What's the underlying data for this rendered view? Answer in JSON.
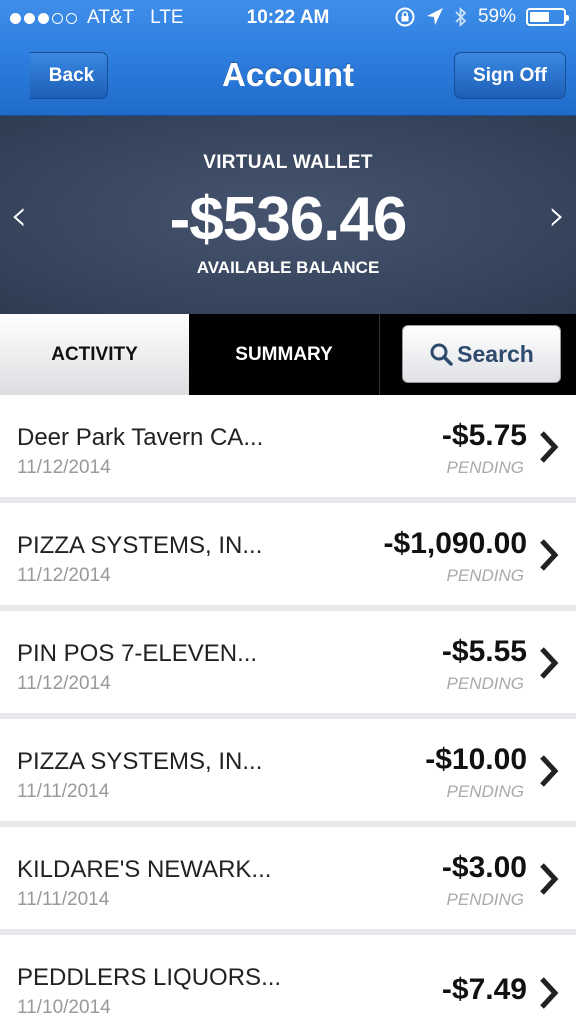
{
  "status_bar": {
    "carrier": "AT&T",
    "network": "LTE",
    "time": "10:22 AM",
    "battery": "59%",
    "battery_level": 0.59,
    "signal_bars_filled": 3,
    "signal_bars_total": 5
  },
  "nav": {
    "back_label": "Back",
    "title": "Account",
    "signoff_label": "Sign Off"
  },
  "balance": {
    "account_name": "VIRTUAL WALLET",
    "amount": "-$536.46",
    "caption": "AVAILABLE BALANCE"
  },
  "tabs": {
    "activity": "ACTIVITY",
    "summary": "SUMMARY",
    "search": "Search"
  },
  "transactions": [
    {
      "name": "Deer Park Tavern   CA...",
      "date": "11/12/2014",
      "amount": "-$5.75",
      "status": "PENDING"
    },
    {
      "name": "PIZZA SYSTEMS, IN...",
      "date": "11/12/2014",
      "amount": "-$1,090.00",
      "status": "PENDING"
    },
    {
      "name": "PIN POS 7-ELEVEN...",
      "date": "11/12/2014",
      "amount": "-$5.55",
      "status": "PENDING"
    },
    {
      "name": "PIZZA SYSTEMS, IN...",
      "date": "11/11/2014",
      "amount": "-$10.00",
      "status": "PENDING"
    },
    {
      "name": "KILDARE'S NEWARK...",
      "date": "11/11/2014",
      "amount": "-$3.00",
      "status": "PENDING"
    },
    {
      "name": "PEDDLERS LIQUORS...",
      "date": "11/10/2014",
      "amount": "-$7.49",
      "status": ""
    }
  ],
  "colors": {
    "nav_blue": "#2f7fe0",
    "balance_panel": "#3d4a63",
    "search_text": "#2e4a6d"
  }
}
